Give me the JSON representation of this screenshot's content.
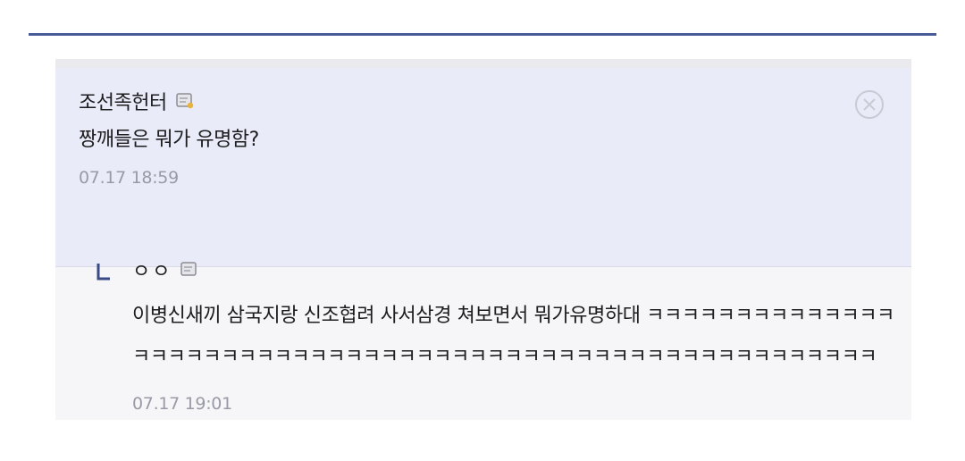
{
  "comment": {
    "author": "조선족헌터",
    "text": "짱깨들은 뭐가 유명함?",
    "timestamp": "07.17 18:59",
    "author_icon": "memo-icon"
  },
  "reply": {
    "author": "ㅇㅇ",
    "text": "이병신새끼 삼국지랑 신조협려 사서삼경 쳐보면서 뭐가유명하대 ㅋㅋㅋㅋㅋㅋㅋㅋㅋㅋㅋㅋㅋㅋㅋㅋㅋㅋㅋㅋㅋㅋㅋㅋㅋㅋㅋㅋㅋㅋㅋㅋㅋㅋㅋㅋㅋㅋㅋㅋㅋㅋㅋㅋㅋㅋㅋㅋㅋㅋㅋㅋㅋㅋㅋㅋ",
    "timestamp": "07.17 19:01",
    "author_icon": "memo-icon"
  },
  "colors": {
    "accent_rule": "#4a5b9a",
    "selected_bg": "#e9ecf8",
    "reply_bg": "#f6f6f9",
    "timestamp": "#9a9aa6"
  }
}
